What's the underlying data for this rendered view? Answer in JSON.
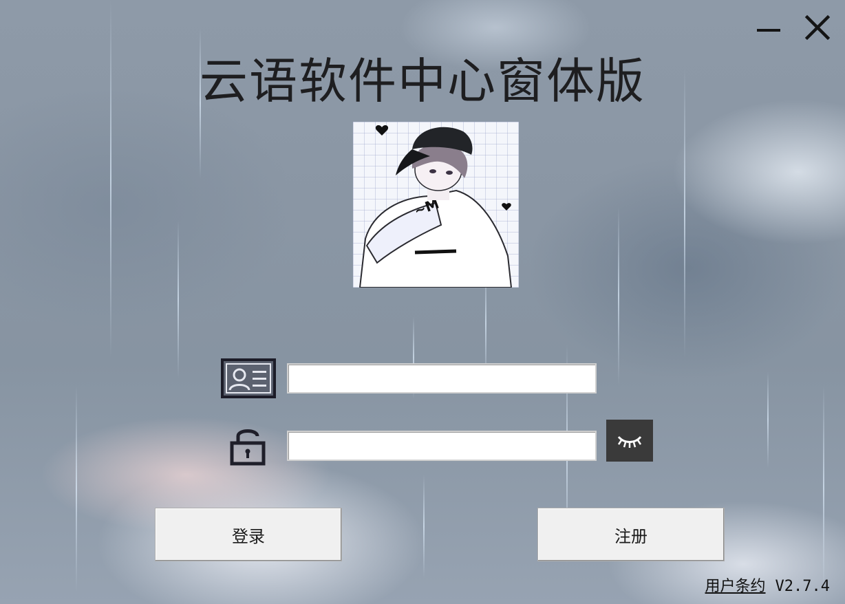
{
  "window": {
    "title": "云语软件中心窗体版",
    "minimize_icon": "minimize-icon",
    "close_icon": "close-icon"
  },
  "avatar": {
    "description_icon": "avatar-image"
  },
  "login_form": {
    "username": {
      "icon": "id-card-icon",
      "value": "",
      "placeholder": ""
    },
    "password": {
      "icon": "lock-icon",
      "value": "",
      "placeholder": "",
      "toggle_icon": "eye-closed-icon"
    }
  },
  "buttons": {
    "login_label": "登录",
    "register_label": "注册"
  },
  "footer": {
    "agreement_label": "用户条约",
    "version": "V2.7.4"
  },
  "colors": {
    "title_text": "#1e1e20",
    "eye_button_bg": "#3a3a3a",
    "button_bg": "#f0f0f0"
  }
}
